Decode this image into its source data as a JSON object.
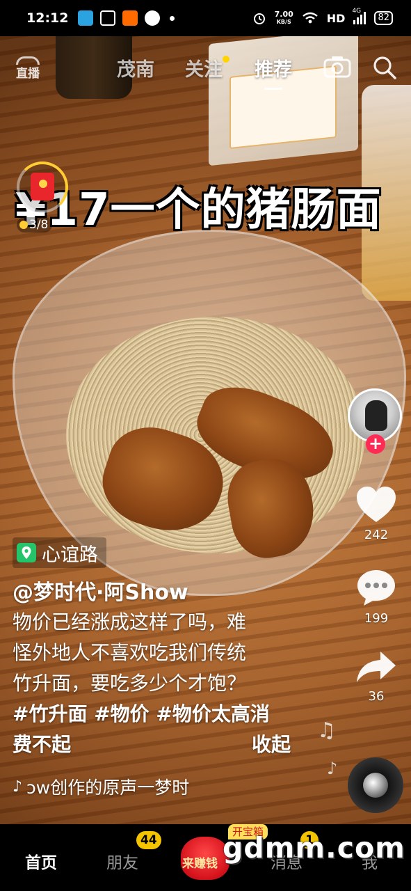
{
  "status_bar": {
    "time": "12:12",
    "net_speed_top": "7.00",
    "net_speed_unit": "KB/S",
    "hd_label": "HD",
    "signal_label": "4G",
    "battery": "82"
  },
  "top_nav": {
    "live_label": "直播",
    "tabs": [
      {
        "label": "茂南",
        "active": false
      },
      {
        "label": "关注",
        "active": false
      },
      {
        "label": "推荐",
        "active": true
      }
    ]
  },
  "video": {
    "headline_overlay": "¥17一个的猪肠面"
  },
  "reward_widget": {
    "progress": "3/8"
  },
  "rail": {
    "likes": "242",
    "comments": "199",
    "shares": "36"
  },
  "info": {
    "location": "心谊路",
    "author": "@梦时代·阿Show",
    "caption_lines": [
      "物价已经涨成这样了吗，难",
      "怪外地人不喜欢吃我们传统",
      "竹升面，要吃多少个才饱？"
    ],
    "tag_line_1": "#竹升面 #物价 #物价太高消",
    "tag_line_2": "费不起",
    "collapse_label": "收起",
    "music_text": "ɔw创作的原声一梦时"
  },
  "tab_bar": {
    "tabs": [
      {
        "label": "首页",
        "active": true
      },
      {
        "label": "朋友",
        "badge": "44"
      },
      {
        "label": "消息",
        "badge": "1"
      },
      {
        "label": "我"
      }
    ],
    "earn_label": "来赚钱",
    "treasure_label": "开宝箱"
  },
  "watermark": "gdmm.com",
  "colors": {
    "accent_pink": "#fe2c55",
    "badge_yellow": "#f5c400",
    "follow_dot": "#ffd400"
  }
}
